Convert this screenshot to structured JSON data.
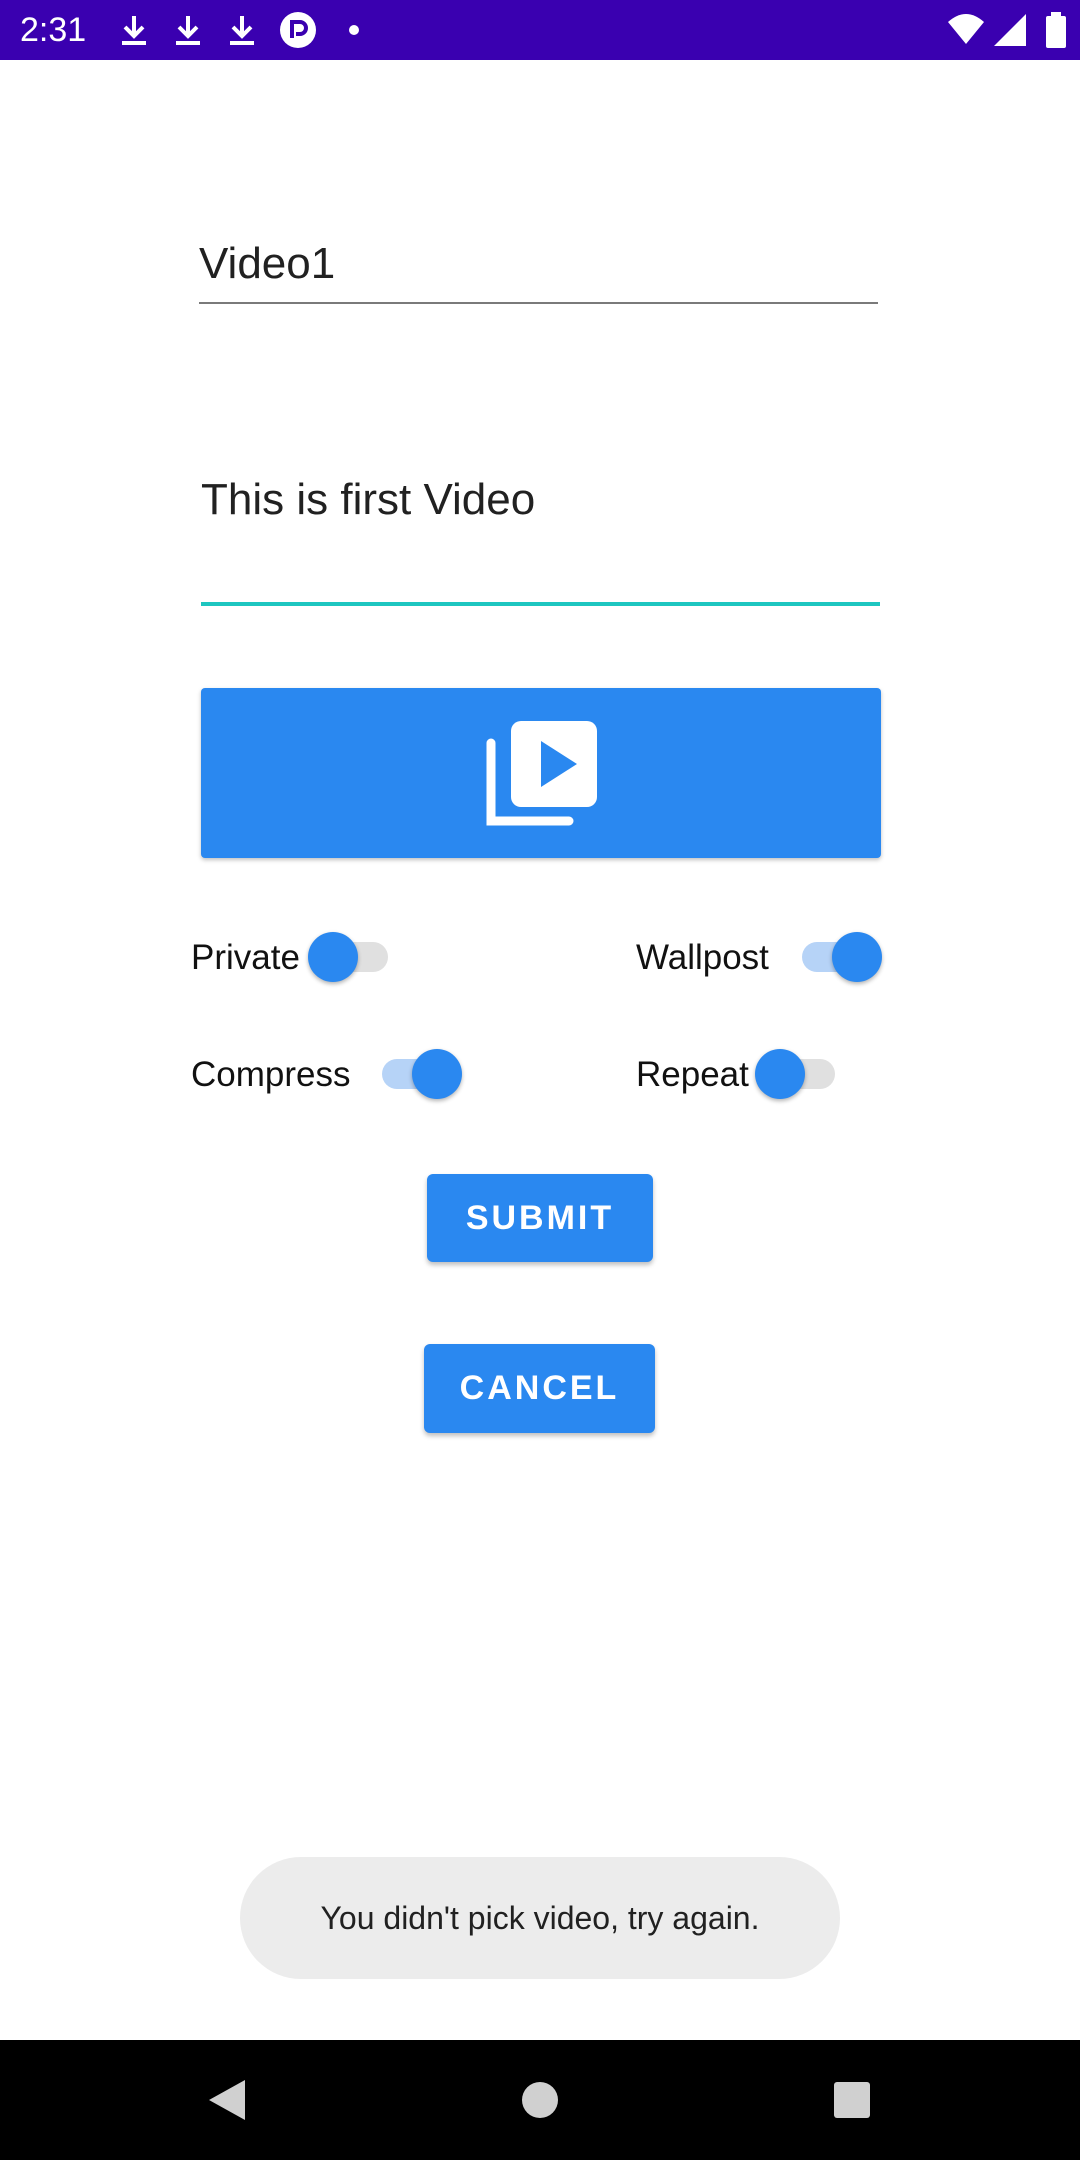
{
  "status_bar": {
    "time": "2:31",
    "left_icons": [
      "download-icon",
      "download-icon",
      "download-icon",
      "app-notification-icon",
      "dot-icon"
    ],
    "right_icons": [
      "wifi-icon",
      "signal-icon",
      "battery-icon"
    ],
    "background_color": "#3a00b0"
  },
  "form": {
    "title_value": "Video1",
    "description_value": "This is first Video",
    "pick_video_icon": "video-library-icon",
    "accent_color": "#2a88f0",
    "focus_underline_color": "#1dc6c0"
  },
  "switches": {
    "private": {
      "label": "Private",
      "checked": false
    },
    "wallpost": {
      "label": "Wallpost",
      "checked": true
    },
    "compress": {
      "label": "Compress",
      "checked": true
    },
    "repeat": {
      "label": "Repeat",
      "checked": false
    }
  },
  "buttons": {
    "submit_label": "SUBMIT",
    "cancel_label": "CANCEL"
  },
  "toast": {
    "message": "You didn't pick video, try again."
  },
  "nav_bar": {
    "icons": [
      "back-icon",
      "home-icon",
      "recents-icon"
    ]
  }
}
